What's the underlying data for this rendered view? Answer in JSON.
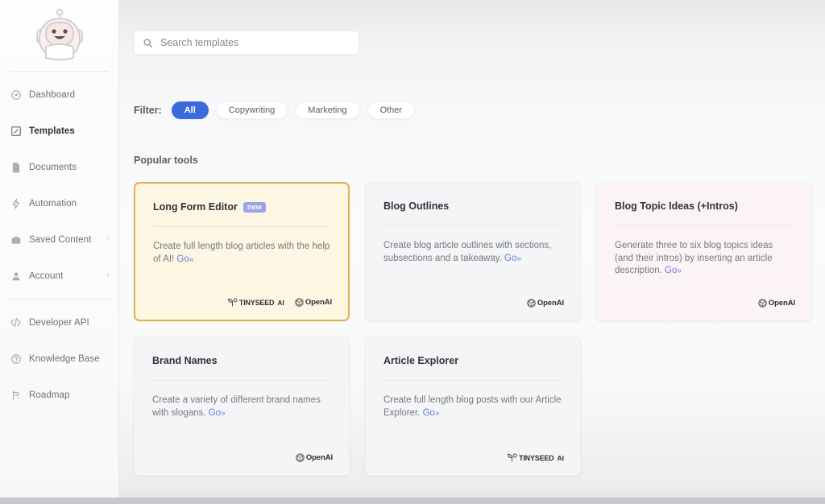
{
  "sidebar": {
    "logo": {
      "name": "robot-logo"
    },
    "items": [
      {
        "label": "Dashboard",
        "icon": "dashboard-icon",
        "active": false,
        "chevron": false
      },
      {
        "label": "Templates",
        "icon": "templates-icon",
        "active": true,
        "chevron": false
      },
      {
        "label": "Documents",
        "icon": "documents-icon",
        "active": false,
        "chevron": false
      },
      {
        "label": "Automation",
        "icon": "automation-icon",
        "active": false,
        "chevron": false
      },
      {
        "label": "Saved Content",
        "icon": "saved-content-icon",
        "active": false,
        "chevron": true
      },
      {
        "label": "Account",
        "icon": "account-icon",
        "active": false,
        "chevron": true
      }
    ],
    "secondary_items": [
      {
        "label": "Developer API",
        "icon": "code-icon",
        "active": false,
        "chevron": false
      },
      {
        "label": "Knowledge Base",
        "icon": "help-circle-icon",
        "active": false,
        "chevron": false
      },
      {
        "label": "Roadmap",
        "icon": "roadmap-icon",
        "active": false,
        "chevron": false
      }
    ]
  },
  "search": {
    "placeholder": "Search templates",
    "value": "",
    "icon": "search-icon"
  },
  "filter": {
    "label": "Filter:",
    "options": [
      {
        "label": "All",
        "active": true
      },
      {
        "label": "Copywriting",
        "active": false
      },
      {
        "label": "Marketing",
        "active": false
      },
      {
        "label": "Other",
        "active": false
      }
    ]
  },
  "section": {
    "heading": "Popular tools"
  },
  "cards": [
    {
      "title": "Long Form Editor",
      "badge": "new",
      "description": "Create full length blog articles with the help of AI!",
      "go_label": "Go",
      "go_chevrons": "»",
      "style": "featured",
      "logos": [
        "tinyseed-ai",
        "openai"
      ]
    },
    {
      "title": "Blog Outlines",
      "badge": "",
      "description": "Create blog article outlines with sections, subsections and a takeaway.",
      "go_label": "Go",
      "go_chevrons": "»",
      "style": "plain",
      "logos": [
        "openai"
      ]
    },
    {
      "title": "Blog Topic Ideas (+Intros)",
      "badge": "",
      "description": "Generate three to six blog topics ideas (and their intros) by inserting an article description.",
      "go_label": "Go",
      "go_chevrons": "»",
      "style": "tinted",
      "logos": [
        "openai"
      ]
    },
    {
      "title": "Brand Names",
      "badge": "",
      "description": "Create a variety of different brand names with slogans.",
      "go_label": "Go",
      "go_chevrons": "»",
      "style": "plain",
      "logos": [
        "openai"
      ]
    },
    {
      "title": "Article Explorer",
      "badge": "",
      "description": "Create full length blog posts with our Article Explorer.",
      "go_label": "Go",
      "go_chevrons": "»",
      "style": "plain",
      "logos": [
        "tinyseed-ai"
      ]
    }
  ],
  "logos": {
    "openai_text": "OpenAI",
    "tinyseed_text": "TINYSEED",
    "tinyseed_suffix": "AI"
  },
  "colors": {
    "accent_blue": "#3b6bdb",
    "link_blue": "#5b7fe0",
    "featured_border": "#e7ad4a",
    "featured_bg": "#fdf6e3",
    "badge_purple": "#9aa3e8"
  }
}
